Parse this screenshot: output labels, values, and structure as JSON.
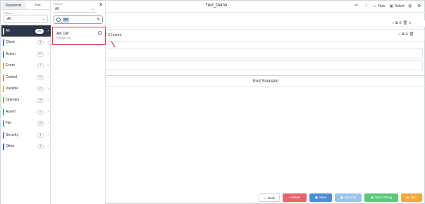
{
  "sidebar": {
    "tabs": [
      {
        "label": "Keywords",
        "active": true
      },
      {
        "label": "Hot",
        "active": false
      }
    ],
    "platform_label": "Platform",
    "platform_value": "All",
    "categories": [
      {
        "label": "All",
        "count": "250",
        "color": "#2d3548",
        "active": true
      },
      {
        "label": "Client",
        "count": "5",
        "color": "#4a6fd6"
      },
      {
        "label": "Action",
        "count": "97",
        "color": "#3a8ee6"
      },
      {
        "label": "Event",
        "count": "7",
        "color": "#f5a623"
      },
      {
        "label": "Control",
        "count": "14",
        "color": "#ef8a3a"
      },
      {
        "label": "Variable",
        "count": "42",
        "color": "#f0b429"
      },
      {
        "label": "Operator",
        "count": "26",
        "color": "#5cc97a"
      },
      {
        "label": "Assert",
        "count": "5",
        "color": "#2fb3a6"
      },
      {
        "label": "File",
        "count": "14",
        "color": "#4aa3df"
      },
      {
        "label": "Security",
        "count": "4",
        "color": "#8e6ad9"
      },
      {
        "label": "Other",
        "count": "3",
        "color": "#3b5bdb"
      }
    ]
  },
  "popup": {
    "platform_label": "Platform",
    "platform_value": "All",
    "search_value": "api",
    "result": {
      "title": "Api Call",
      "subtitle": "Platform: Api"
    }
  },
  "main": {
    "title": "Test_Demo",
    "toolbar": {
      "flow_label": "Flow",
      "select_label": "Select"
    },
    "client_label": "Client",
    "end_label": "End Scenario"
  },
  "footer": {
    "back": "Back",
    "delete": "Delete",
    "save": "Save",
    "save_as": "Save as",
    "debug": "Start Debug",
    "run": "Run"
  },
  "colors": {
    "accent_red": "#d9363e",
    "active_dark": "#2d3548"
  },
  "icons": [
    "search-icon",
    "close-icon",
    "info-icon",
    "undo-icon",
    "bell-icon",
    "flow-icon",
    "select-icon",
    "settings-icon",
    "copy-icon",
    "delete-icon",
    "arrow-left-icon"
  ]
}
